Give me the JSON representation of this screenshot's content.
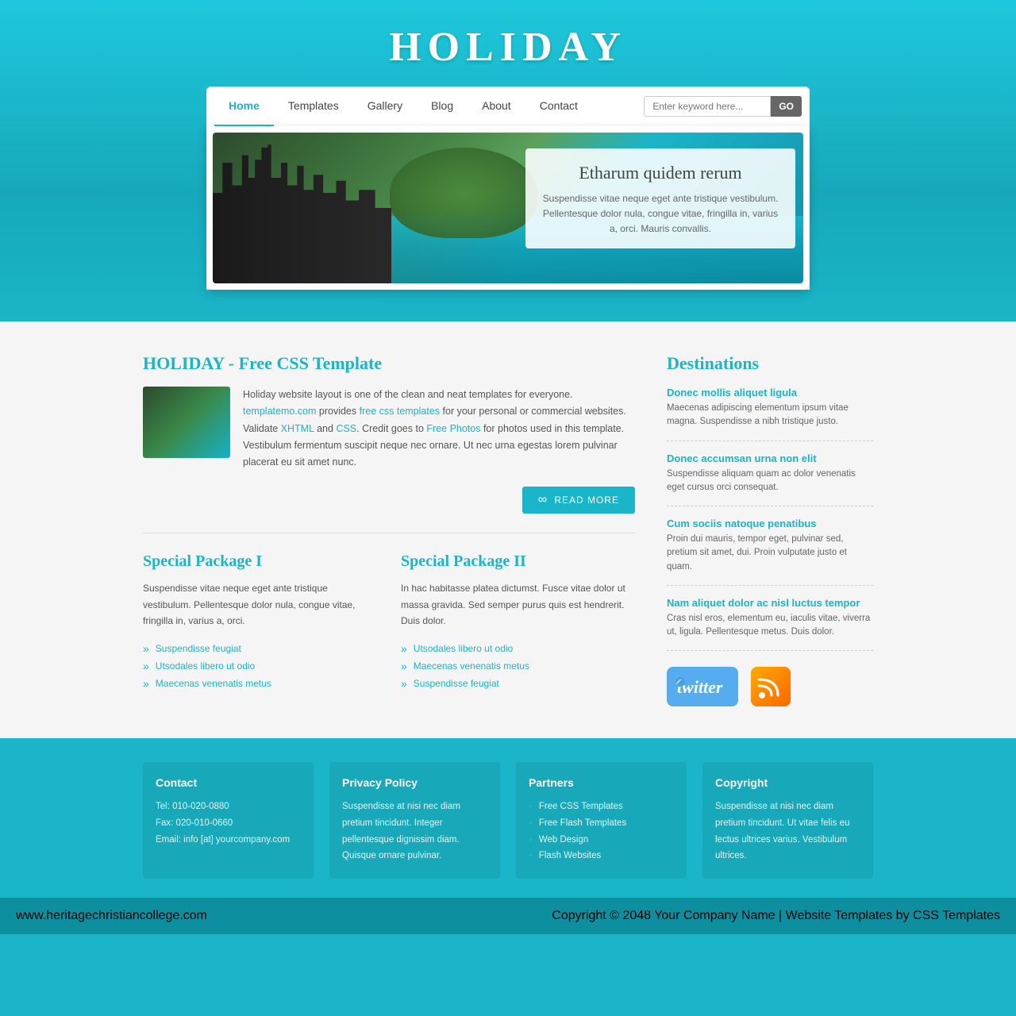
{
  "site": {
    "title": "HOLIDAY",
    "url": "www.heritagechristiancollege.com"
  },
  "nav": {
    "links": [
      {
        "label": "Home",
        "active": true
      },
      {
        "label": "Templates",
        "active": false
      },
      {
        "label": "Gallery",
        "active": false
      },
      {
        "label": "Blog",
        "active": false
      },
      {
        "label": "About",
        "active": false
      },
      {
        "label": "Contact",
        "active": false
      }
    ],
    "search_placeholder": "Enter keyword here...",
    "search_button": "GO"
  },
  "hero": {
    "heading": "Etharum quidem rerum",
    "text": "Suspendisse vitae neque eget ante tristique vestibulum. Pellentesque dolor nula, congue vitae, fringilla in, varius a, orci. Mauris convallis."
  },
  "main": {
    "section_title": "HOLIDAY - Free CSS Template",
    "intro_text": "Holiday website layout is one of the clean and neat templates for everyone. templatemo.com provides free css templates for your personal or commercial websites. Validate XHTML and CSS. Credit goes to Free Photos for photos used in this template. Vestibulum fermentum suscipit neque nec ornare. Ut nec urna egestas lorem pulvinar placerat eu sit amet nunc.",
    "read_more": "READ MORE",
    "packages": [
      {
        "title": "Special Package I",
        "text": "Suspendisse vitae neque eget ante tristique vestibulum. Pellentesque dolor nula, congue vitae, fringilla in, varius a, orci.",
        "items": [
          "Suspendisse feugiat",
          "Utsodales libero ut odio",
          "Maecenas venenatis metus"
        ]
      },
      {
        "title": "Special Package II",
        "text": "In hac habitasse platea dictumst. Fusce vitae dolor ut massa gravida. Sed semper purus quis est hendrerit. Duis dolor.",
        "items": [
          "Utsodales libero ut odio",
          "Maecenas venenatis metus",
          "Suspendisse feugiat"
        ]
      }
    ]
  },
  "destinations": {
    "title": "Destinations",
    "items": [
      {
        "link": "Donec mollis aliquet ligula",
        "desc": "Maecenas adipiscing elementum ipsum vitae magna. Suspendisse a nibh tristique justo."
      },
      {
        "link": "Donec accumsan urna non elit",
        "desc": "Suspendisse aliquam quam ac dolor venenatis eget cursus orci consequat."
      },
      {
        "link": "Cum sociis natoque penatibus",
        "desc": "Proin dui mauris, tempor eget, pulvinar sed, pretium sit amet, dui. Proin vulputate justo et quam."
      },
      {
        "link": "Nam aliquet dolor ac nisl luctus tempor",
        "desc": "Cras nisl eros, elementum eu, iaculis vitae, viverra ut, ligula. Pellentesque metus. Duis dolor."
      }
    ]
  },
  "footer": {
    "columns": [
      {
        "title": "Contact",
        "lines": [
          "Tel: 010-020-0880",
          "Fax: 020-010-0660",
          "Email: info [at] yourcompany.com"
        ]
      },
      {
        "title": "Privacy Policy",
        "text": "Suspendisse at nisi nec diam pretium tincidunt. Integer pellentesque dignissim diam. Quisque ornare pulvinar."
      },
      {
        "title": "Partners",
        "links": [
          "Free CSS Templates",
          "Free Flash Templates",
          "Web Design",
          "Flash Websites"
        ]
      },
      {
        "title": "Copyright",
        "text": "Suspendisse at nisi nec diam pretium tincidunt. Ut vitae felis eu lectus ultrices varius. Vestibulum ultrices."
      }
    ],
    "bottom": {
      "left": "www.heritagechristiancollege.com",
      "copyright": "Copyright © 2048",
      "company": "Your Company Name",
      "separator1": "|",
      "website_templates": "Website Templates",
      "separator2": "by",
      "css_templates": "CSS Templates"
    }
  }
}
